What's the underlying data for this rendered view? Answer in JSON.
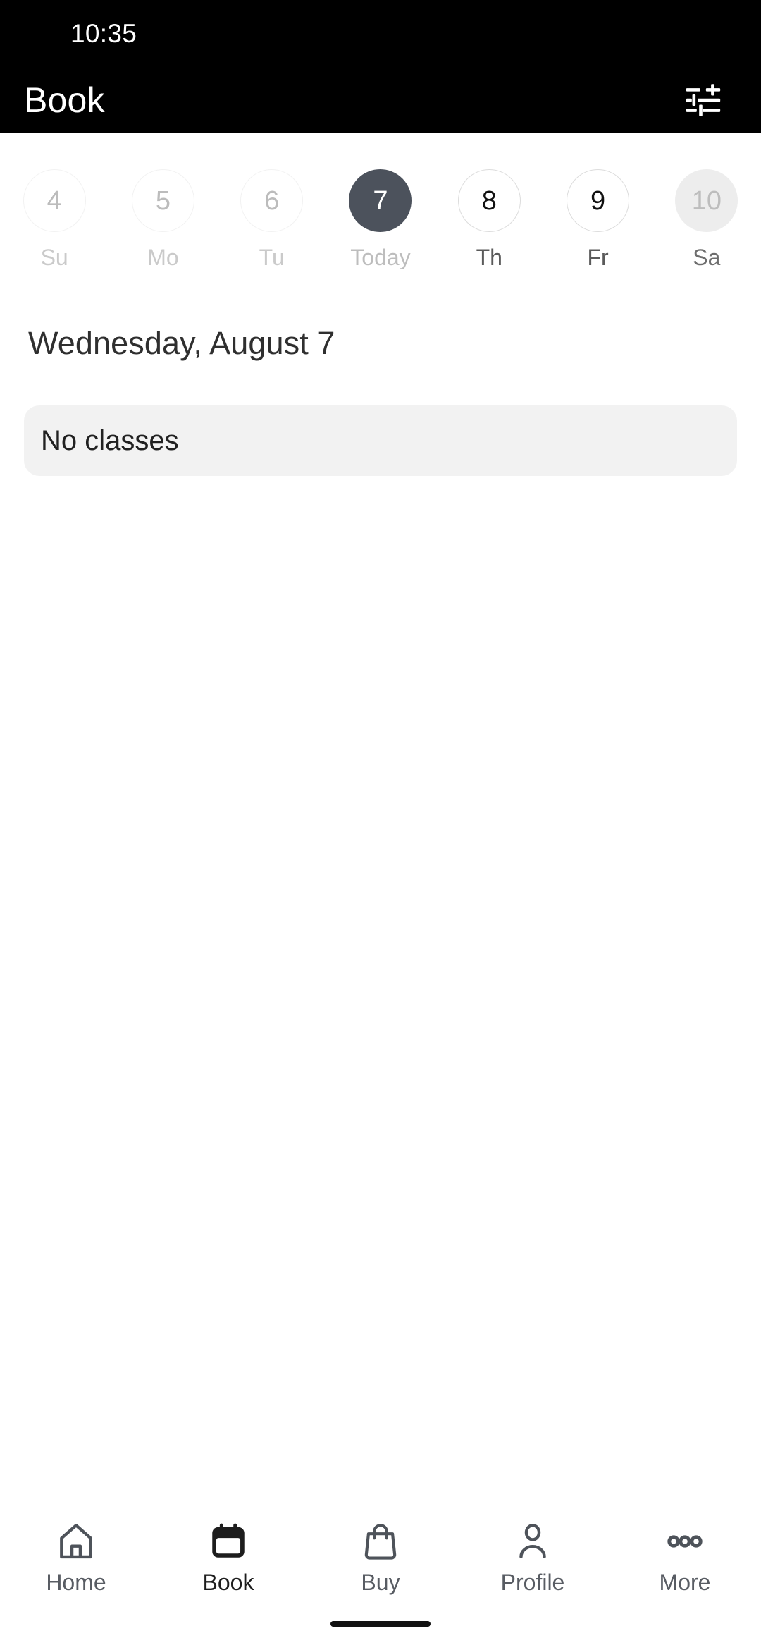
{
  "status_bar": {
    "time": "10:35"
  },
  "app_bar": {
    "title": "Book",
    "filter_icon": "tune-filter-icon"
  },
  "date_strip": {
    "days": [
      {
        "date": "4",
        "label": "Su",
        "state": "past"
      },
      {
        "date": "5",
        "label": "Mo",
        "state": "past"
      },
      {
        "date": "6",
        "label": "Tu",
        "state": "past"
      },
      {
        "date": "7",
        "label": "Today",
        "state": "selected"
      },
      {
        "date": "8",
        "label": "Th",
        "state": "future"
      },
      {
        "date": "9",
        "label": "Fr",
        "state": "future"
      },
      {
        "date": "10",
        "label": "Sa",
        "state": "disabled"
      }
    ]
  },
  "main": {
    "date_heading": "Wednesday, August 7",
    "classes_card": {
      "text": "No classes"
    }
  },
  "bottom_nav": {
    "items": [
      {
        "label": "Home",
        "icon": "home-icon",
        "active": false
      },
      {
        "label": "Book",
        "icon": "calendar-icon",
        "active": true
      },
      {
        "label": "Buy",
        "icon": "shopping-bag-icon",
        "active": false
      },
      {
        "label": "Profile",
        "icon": "person-icon",
        "active": false
      },
      {
        "label": "More",
        "icon": "more-dots-icon",
        "active": false
      }
    ]
  },
  "colors": {
    "app_bar_bg": "#000000",
    "selected_day_bg": "#4c525c",
    "card_bg": "#f2f2f2",
    "nav_icon": "#4e535a",
    "nav_active": "#1d1d1d",
    "page_bg": "#ffffff"
  }
}
